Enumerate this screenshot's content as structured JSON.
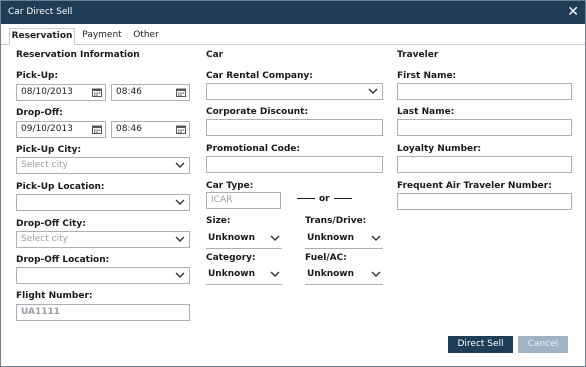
{
  "window": {
    "title": "Car Direct Sell",
    "close_glyph": "✕"
  },
  "tabs": [
    {
      "label": "Reservation",
      "active": true
    },
    {
      "label": "Payment",
      "active": false
    },
    {
      "label": "Other",
      "active": false
    }
  ],
  "reservation": {
    "section_title": "Reservation Information",
    "pickup": {
      "label": "Pick-Up:",
      "date": "08/10/2013",
      "time": "08:46"
    },
    "dropoff": {
      "label": "Drop-Off:",
      "date": "09/10/2013",
      "time": "08:46"
    },
    "pickup_city": {
      "label": "Pick-Up City:",
      "placeholder": "Select city"
    },
    "pickup_location": {
      "label": "Pick-Up Location:",
      "value": ""
    },
    "dropoff_city": {
      "label": "Drop-Off City:",
      "placeholder": "Select city"
    },
    "dropoff_location": {
      "label": "Drop-Off Location:",
      "value": ""
    },
    "flight_number": {
      "label": "Flight Number:",
      "placeholder": "UA1111"
    }
  },
  "car": {
    "section_title": "Car",
    "rental_company": {
      "label": "Car Rental Company:",
      "value": ""
    },
    "corporate_discount": {
      "label": "Corporate Discount:",
      "value": ""
    },
    "promotional_code": {
      "label": "Promotional Code:",
      "value": ""
    },
    "car_type": {
      "label": "Car Type:",
      "placeholder": "ICAR"
    },
    "or_text": "or",
    "size": {
      "label": "Size:",
      "value": "Unknown"
    },
    "trans_drive": {
      "label": "Trans/Drive:",
      "value": "Unknown"
    },
    "category": {
      "label": "Category:",
      "value": "Unknown"
    },
    "fuel_ac": {
      "label": "Fuel/AC:",
      "value": "Unknown"
    }
  },
  "traveler": {
    "section_title": "Traveler",
    "first_name": {
      "label": "First Name:",
      "value": ""
    },
    "last_name": {
      "label": "Last Name:",
      "value": ""
    },
    "loyalty_number": {
      "label": "Loyalty Number:",
      "value": ""
    },
    "frequent_air": {
      "label": "Frequent Air Traveler Number:",
      "value": ""
    }
  },
  "buttons": {
    "direct_sell": "Direct Sell",
    "cancel": "Cancel"
  },
  "icons": {
    "calendar": "calendar-icon",
    "chevron": "chevron-down-icon",
    "close": "close-icon"
  },
  "colors": {
    "titlebar": "#1f3d57",
    "primary_button": "#1f3d57",
    "cancel_button": "#9fb3c3",
    "border": "#a9b0b7"
  }
}
